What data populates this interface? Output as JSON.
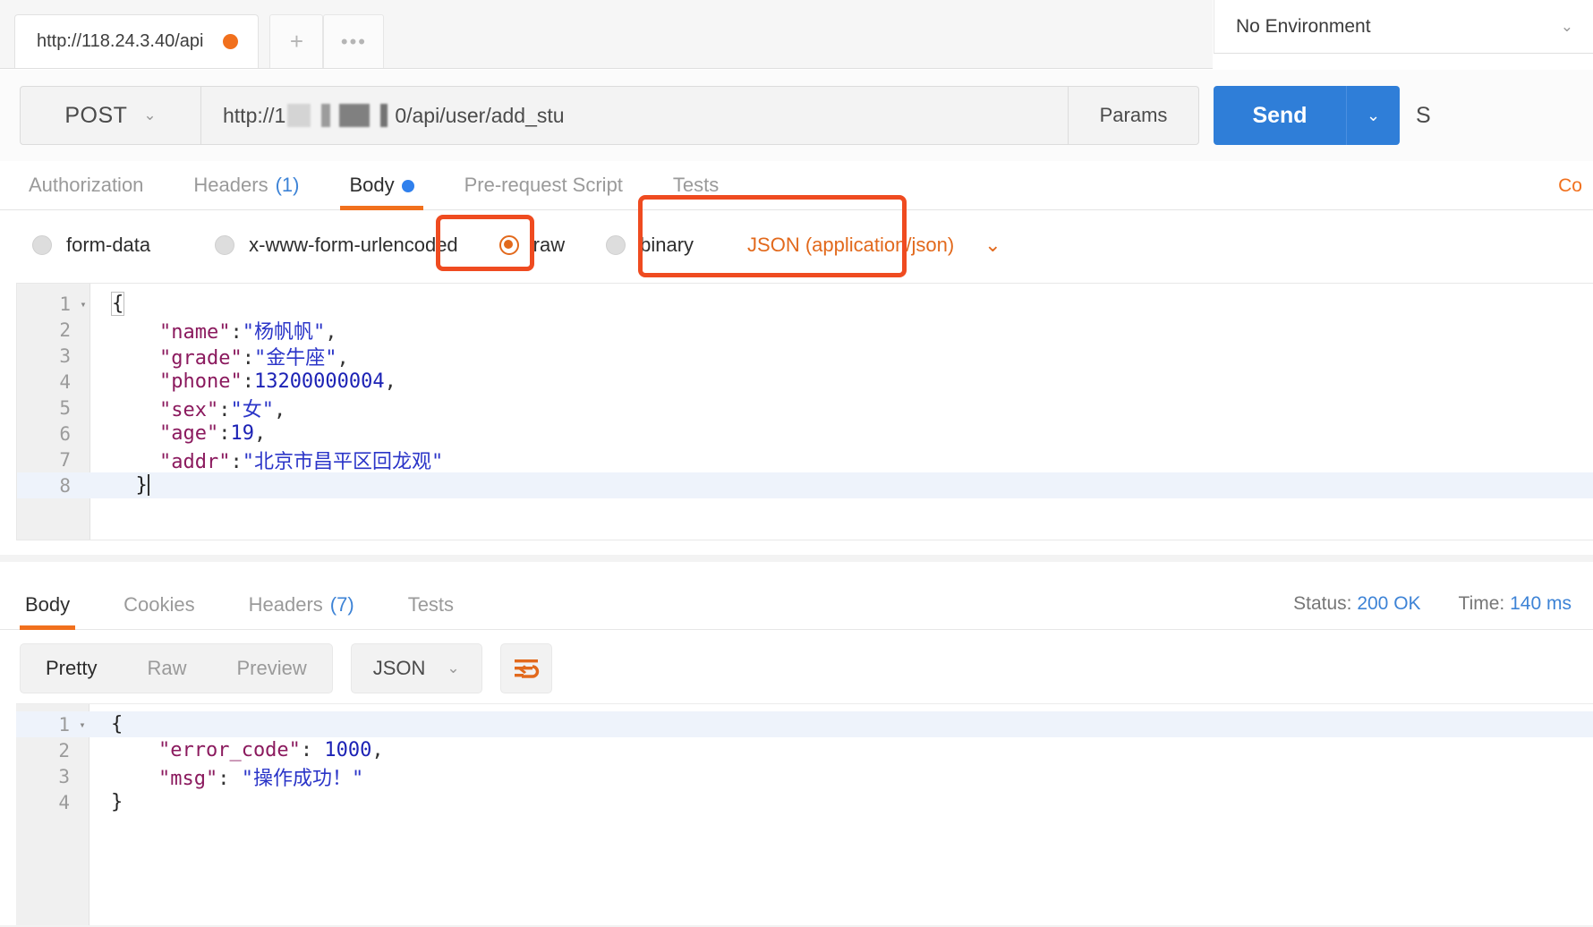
{
  "window": {
    "tab": {
      "title": "http://118.24.3.40/api",
      "unsaved_dot": "unsaved-dot"
    },
    "new_tab_label": "+",
    "more_tabs_label": "•••",
    "environment": {
      "label": "No Environment",
      "caret": "⌄"
    }
  },
  "request": {
    "method": "POST",
    "method_caret": "⌄",
    "url_prefix": "http://1",
    "url_suffix": "0/api/user/add_stu",
    "url_full": "http://118.24.3.40/api/user/add_stu",
    "params_label": "Params",
    "send_label": "Send",
    "send_caret": "⌄",
    "save_label": "S",
    "tabs": [
      {
        "label": "Authorization",
        "count": "",
        "active": false,
        "dot": false
      },
      {
        "label": "Headers",
        "count": "(1)",
        "active": false,
        "dot": false
      },
      {
        "label": "Body",
        "count": "",
        "active": true,
        "dot": true
      },
      {
        "label": "Pre-request Script",
        "count": "",
        "active": false,
        "dot": false
      },
      {
        "label": "Tests",
        "count": "",
        "active": false,
        "dot": false
      }
    ],
    "cookies_link": "Co",
    "body_types": [
      {
        "label": "form-data",
        "selected": false
      },
      {
        "label": "x-www-form-urlencoded",
        "selected": false
      },
      {
        "label": "raw",
        "selected": true
      },
      {
        "label": "binary",
        "selected": false
      }
    ],
    "content_type": {
      "label": "JSON (application/json)",
      "caret": "⌄"
    },
    "body_lines": [
      {
        "num": "1",
        "fold": "▾",
        "highlight": false,
        "parts": [
          {
            "t": "{",
            "c": "brace-box k-brace"
          }
        ]
      },
      {
        "num": "2",
        "fold": "",
        "highlight": false,
        "parts": [
          {
            "t": "    \"name\"",
            "c": "k-key"
          },
          {
            "t": ":",
            "c": "k-pun"
          },
          {
            "t": "\"杨帆帆\"",
            "c": "k-str"
          },
          {
            "t": ",",
            "c": "k-pun"
          }
        ]
      },
      {
        "num": "3",
        "fold": "",
        "highlight": false,
        "parts": [
          {
            "t": "    \"grade\"",
            "c": "k-key"
          },
          {
            "t": ":",
            "c": "k-pun"
          },
          {
            "t": "\"金牛座\"",
            "c": "k-str"
          },
          {
            "t": ",",
            "c": "k-pun"
          }
        ]
      },
      {
        "num": "4",
        "fold": "",
        "highlight": false,
        "parts": [
          {
            "t": "    \"phone\"",
            "c": "k-key"
          },
          {
            "t": ":",
            "c": "k-pun"
          },
          {
            "t": "13200000004",
            "c": "k-num"
          },
          {
            "t": ",",
            "c": "k-pun"
          }
        ]
      },
      {
        "num": "5",
        "fold": "",
        "highlight": false,
        "parts": [
          {
            "t": "    \"sex\"",
            "c": "k-key"
          },
          {
            "t": ":",
            "c": "k-pun"
          },
          {
            "t": "\"女\"",
            "c": "k-str"
          },
          {
            "t": ",",
            "c": "k-pun"
          }
        ]
      },
      {
        "num": "6",
        "fold": "",
        "highlight": false,
        "parts": [
          {
            "t": "    \"age\"",
            "c": "k-key"
          },
          {
            "t": ":",
            "c": "k-pun"
          },
          {
            "t": "19",
            "c": "k-num"
          },
          {
            "t": ",",
            "c": "k-pun"
          }
        ]
      },
      {
        "num": "7",
        "fold": "",
        "highlight": false,
        "parts": [
          {
            "t": "    \"addr\"",
            "c": "k-key"
          },
          {
            "t": ":",
            "c": "k-pun"
          },
          {
            "t": "\"北京市昌平区回龙观\"",
            "c": "k-str"
          }
        ]
      },
      {
        "num": "8",
        "fold": "",
        "highlight": true,
        "parts": [
          {
            "t": "  }",
            "c": "k-brace"
          }
        ]
      }
    ]
  },
  "response": {
    "tabs": [
      {
        "label": "Body",
        "count": "",
        "active": true
      },
      {
        "label": "Cookies",
        "count": "",
        "active": false
      },
      {
        "label": "Headers",
        "count": "(7)",
        "active": false
      },
      {
        "label": "Tests",
        "count": "",
        "active": false
      }
    ],
    "status_label": "Status:",
    "status_value": "200 OK",
    "time_label": "Time:",
    "time_value": "140 ms",
    "view_modes": [
      {
        "label": "Pretty",
        "active": true
      },
      {
        "label": "Raw",
        "active": false
      },
      {
        "label": "Preview",
        "active": false
      }
    ],
    "format": {
      "label": "JSON",
      "caret": "⌄"
    },
    "wrap_icon": "word-wrap-icon",
    "body_lines": [
      {
        "num": "1",
        "fold": "▾",
        "highlight": true,
        "parts": [
          {
            "t": "{",
            "c": "k-brace"
          }
        ]
      },
      {
        "num": "2",
        "fold": "",
        "highlight": false,
        "parts": [
          {
            "t": "    \"error_code\"",
            "c": "k-key"
          },
          {
            "t": ": ",
            "c": "k-pun"
          },
          {
            "t": "1000",
            "c": "k-num"
          },
          {
            "t": ",",
            "c": "k-pun"
          }
        ]
      },
      {
        "num": "3",
        "fold": "",
        "highlight": false,
        "parts": [
          {
            "t": "    \"msg\"",
            "c": "k-key"
          },
          {
            "t": ": ",
            "c": "k-pun"
          },
          {
            "t": "\"操作成功！\"",
            "c": "k-str"
          }
        ]
      },
      {
        "num": "4",
        "fold": "",
        "highlight": false,
        "parts": [
          {
            "t": "}",
            "c": "k-brace"
          }
        ]
      }
    ]
  },
  "colors": {
    "accent_orange": "#f1701d",
    "highlight_orange": "#ef4b20",
    "send_blue": "#2f7ed8",
    "link_blue": "#3d83d6",
    "json_key": "#8b1a5e",
    "json_string": "#2b35c8",
    "json_number": "#1c22b5"
  }
}
